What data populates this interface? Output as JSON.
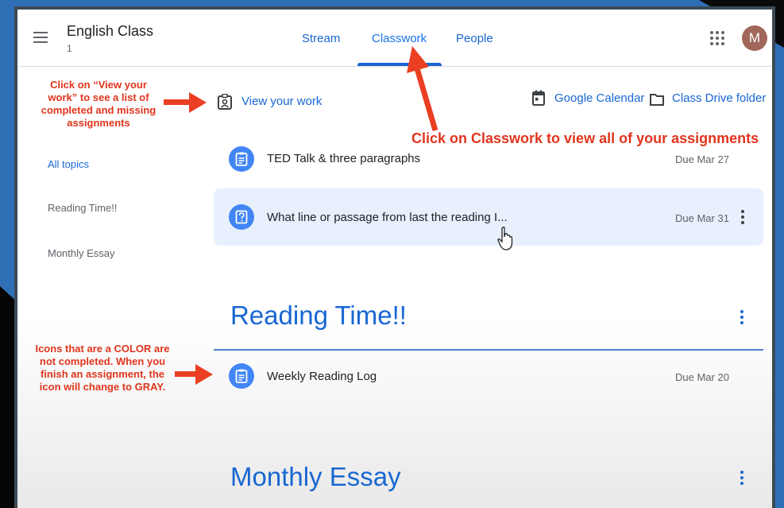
{
  "header": {
    "class_name": "English Class",
    "class_section": "1",
    "tabs": [
      {
        "label": "Stream",
        "active": false
      },
      {
        "label": "Classwork",
        "active": true
      },
      {
        "label": "People",
        "active": false
      }
    ],
    "avatar_letter": "M",
    "accent_color": "#1967d2"
  },
  "toolbar": {
    "view_work": "View your work",
    "calendar": "Google Calendar",
    "drive": "Class Drive folder"
  },
  "sidebar": {
    "items": [
      {
        "label": "All topics",
        "active": true
      },
      {
        "label": "Reading Time!!",
        "active": false
      },
      {
        "label": "Monthly Essay",
        "active": false
      }
    ]
  },
  "assignments": [
    {
      "title": "TED Talk & three paragraphs",
      "due": "Due Mar 27",
      "icon": "assignment-icon"
    },
    {
      "title": "What line or passage from last the reading I...",
      "due": "Due Mar 31",
      "icon": "question-icon"
    }
  ],
  "sections": [
    {
      "title": "Reading Time!!",
      "items": [
        {
          "title": "Weekly Reading Log",
          "due": "Due Mar 20",
          "icon": "assignment-icon"
        }
      ]
    },
    {
      "title": "Monthly Essay",
      "items": []
    }
  ],
  "annotations": {
    "view_work_note": "Click on “View your work” to see a list of completed and missing assignments",
    "classwork_note": "Click on Classwork to view all of your assignments",
    "icon_note": "Icons that are a COLOR are not completed. When you finish an assignment, the icon will change to GRAY."
  }
}
